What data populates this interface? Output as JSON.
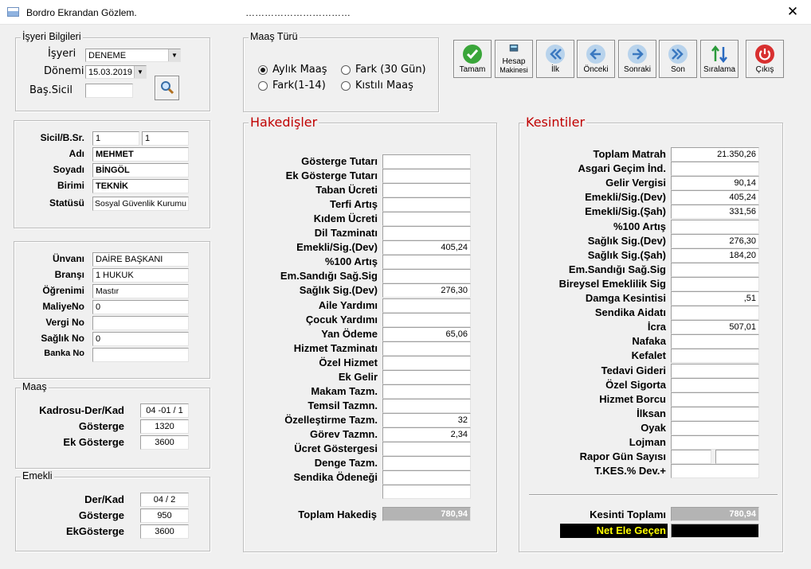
{
  "window": {
    "title": "Bordro Ekrandan Gözlem.",
    "dots": "……………………………"
  },
  "isyeri": {
    "legend": "İşyeri Bilgileri",
    "isyeri_label": "İşyeri",
    "isyeri_value": "DENEME",
    "donemi_label": "Dönemi",
    "donemi_value": "15.03.2019",
    "bas_sicil_label": "Baş.Sicil",
    "bas_sicil_value": ""
  },
  "personel": {
    "sicil_label": "Sicil/B.Sr.",
    "sicil": "1",
    "bsr": "1",
    "adi_label": "Adı",
    "adi": "MEHMET",
    "soyadi_label": "Soyadı",
    "soyadi": "BİNGÖL",
    "birimi_label": "Birimi",
    "birimi": "TEKNİK",
    "statusu_label": "Statüsü",
    "statusu": "Sosyal Güvenlik Kurumu"
  },
  "unvan": {
    "unvani_label": "Ünvanı",
    "unvani": "DAİRE BAŞKANI",
    "bransi_label": "Branşı",
    "bransi": "1 HUKUK",
    "ogrenimi_label": "Öğrenimi",
    "ogrenimi": "Mastır",
    "maliyeno_label": "MaliyeNo",
    "maliyeno": "0",
    "vergino_label": "Vergi No",
    "vergino": "",
    "saglikno_label": "Sağlık No",
    "saglikno": "0",
    "bankano_label": "Banka No",
    "bankano": ""
  },
  "maas": {
    "legend": "Maaş",
    "kadro_label": "Kadrosu-Der/Kad",
    "kadro": "04 -01 / 1",
    "gosterge_label": "Gösterge",
    "gosterge": "1320",
    "ekgosterge_label": "Ek Gösterge",
    "ekgosterge": "3600"
  },
  "emekli": {
    "legend": "Emekli",
    "derkad_label": "Der/Kad",
    "derkad": "04 / 2",
    "gosterge_label": "Gösterge",
    "gosterge": "950",
    "ekgosterge_label": "EkGösterge",
    "ekgosterge": "3600"
  },
  "maas_turu": {
    "legend": "Maaş Türü",
    "aylik": "Aylık Maaş",
    "fark30": "Fark (30 Gün)",
    "fark114": "Fark(1-14)",
    "kistli": "Kıstılı Maaş"
  },
  "toolbar": {
    "tamam": "Tamam",
    "hesap1": "Hesap",
    "hesap2": "Makinesi",
    "ilk": "İlk",
    "onceki": "Önceki",
    "sonraki": "Sonraki",
    "son": "Son",
    "siralama": "Sıralama",
    "cikis": "Çıkış"
  },
  "hakedisler": {
    "legend": "Hakedişler",
    "rows": [
      {
        "label": "Gösterge Tutarı",
        "value": ""
      },
      {
        "label": "Ek Gösterge Tutarı",
        "value": ""
      },
      {
        "label": "Taban Ücreti",
        "value": ""
      },
      {
        "label": "Terfi Artış",
        "value": ""
      },
      {
        "label": "Kıdem Ücreti",
        "value": ""
      },
      {
        "label": "Dil Tazminatı",
        "value": ""
      },
      {
        "label": "Emekli/Sig.(Dev)",
        "value": "405,24"
      },
      {
        "label": "%100 Artış",
        "value": ""
      },
      {
        "label": "Em.Sandığı Sağ.Sig",
        "value": ""
      },
      {
        "label": "Sağlık Sig.(Dev)",
        "value": "276,30"
      },
      {
        "label": "Aile Yardımı",
        "value": ""
      },
      {
        "label": "Çocuk Yardımı",
        "value": ""
      },
      {
        "label": "Yan Ödeme",
        "value": "65,06"
      },
      {
        "label": "Hizmet Tazminatı",
        "value": ""
      },
      {
        "label": "Özel Hizmet",
        "value": ""
      },
      {
        "label": "Ek Gelir",
        "value": ""
      },
      {
        "label": "Makam Tazm.",
        "value": ""
      },
      {
        "label": "Temsil Tazmn.",
        "value": ""
      },
      {
        "label": "Özelleştirme Tazm.",
        "value": "32"
      },
      {
        "label": "Görev Tazmn.",
        "value": "2,34"
      },
      {
        "label": "Ücret Göstergesi",
        "value": ""
      },
      {
        "label": "Denge Tazm.",
        "value": ""
      },
      {
        "label": "Sendika Ödeneği",
        "value": ""
      },
      {
        "label": "",
        "value": ""
      }
    ],
    "toplam_label": "Toplam Hakediş",
    "toplam": "780,94"
  },
  "kesintiler": {
    "legend": "Kesintiler",
    "rows": [
      {
        "label": "Toplam Matrah",
        "value": "21.350,26"
      },
      {
        "label": "Asgari Geçim İnd.",
        "value": ""
      },
      {
        "label": "Gelir Vergisi",
        "value": "90,14"
      },
      {
        "label": "Emekli/Sig.(Dev)",
        "value": "405,24"
      },
      {
        "label": "Emekli/Sig.(Şah)",
        "value": "331,56"
      },
      {
        "label": "%100 Artış",
        "value": ""
      },
      {
        "label": "Sağlık Sig.(Dev)",
        "value": "276,30"
      },
      {
        "label": "Sağlık Sig.(Şah)",
        "value": "184,20"
      },
      {
        "label": "Em.Sandığı Sağ.Sig",
        "value": ""
      },
      {
        "label": "Bireysel Emeklilik Sig",
        "value": ""
      },
      {
        "label": "Damga Kesintisi",
        "value": ",51"
      },
      {
        "label": "Sendika Aidatı",
        "value": ""
      },
      {
        "label": "İcra",
        "value": "507,01"
      },
      {
        "label": "Nafaka",
        "value": ""
      },
      {
        "label": "Kefalet",
        "value": ""
      },
      {
        "label": "Tedavi Gideri",
        "value": ""
      },
      {
        "label": "Özel Sigorta",
        "value": ""
      },
      {
        "label": "Hizmet Borcu",
        "value": ""
      },
      {
        "label": "İlksan",
        "value": ""
      },
      {
        "label": "Oyak",
        "value": ""
      },
      {
        "label": "Lojman",
        "value": ""
      },
      {
        "label": "Rapor Gün Sayısı",
        "value": ""
      },
      {
        "label": "T.KES.% Dev.+",
        "value": ""
      }
    ],
    "toplam_label": "Kesinti Toplamı",
    "toplam": "780,94",
    "net_label": "Net Ele Geçen",
    "net": ""
  }
}
